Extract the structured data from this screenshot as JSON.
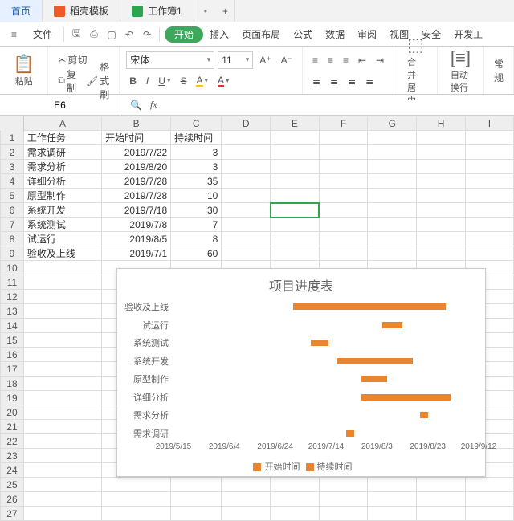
{
  "tabs": [
    {
      "label": "首页",
      "active": true,
      "icon": ""
    },
    {
      "label": "稻壳模板",
      "active": false,
      "icon": "red"
    },
    {
      "label": "工作簿1",
      "active": false,
      "icon": "green"
    }
  ],
  "menu": {
    "file": "文件",
    "items": [
      "开始",
      "插入",
      "页面布局",
      "公式",
      "数据",
      "审阅",
      "视图",
      "安全",
      "开发工"
    ],
    "activeIndex": 0
  },
  "ribbon": {
    "paste": "粘贴",
    "cut": "剪切",
    "copy": "复制",
    "format_painter": "格式刷",
    "font": "宋体",
    "size": "11",
    "bold": "B",
    "italic": "I",
    "underline": "U",
    "strike": "S",
    "fill": "A",
    "textcolor": "A",
    "merge": "合并居中",
    "wrap": "自动换行",
    "general": "常规"
  },
  "namebox": "E6",
  "fx_label": "fx",
  "columns": [
    "A",
    "B",
    "C",
    "D",
    "E",
    "F",
    "G",
    "H",
    "I"
  ],
  "rows_count": 27,
  "headers": {
    "task": "工作任务",
    "start": "开始时间",
    "dur": "持续时间"
  },
  "data": [
    {
      "task": "需求调研",
      "start": "2019/7/22",
      "dur": 3
    },
    {
      "task": "需求分析",
      "start": "2019/8/20",
      "dur": 3
    },
    {
      "task": "详细分析",
      "start": "2019/7/28",
      "dur": 35
    },
    {
      "task": "原型制作",
      "start": "2019/7/28",
      "dur": 10
    },
    {
      "task": "系统开发",
      "start": "2019/7/18",
      "dur": 30
    },
    {
      "task": "系统测试",
      "start": "2019/7/8",
      "dur": 7
    },
    {
      "task": "试运行",
      "start": "2019/8/5",
      "dur": 8
    },
    {
      "task": "验收及上线",
      "start": "2019/7/1",
      "dur": 60
    }
  ],
  "chart_data": {
    "type": "bar",
    "title": "项目进度表",
    "orientation": "horizontal",
    "x_axis_type": "date",
    "x_ticks": [
      "2019/5/15",
      "2019/6/4",
      "2019/6/24",
      "2019/7/14",
      "2019/8/3",
      "2019/8/23",
      "2019/9/12"
    ],
    "x_range": [
      "2019/5/15",
      "2019/9/12"
    ],
    "categories": [
      "验收及上线",
      "试运行",
      "系统测试",
      "系统开发",
      "原型制作",
      "详细分析",
      "需求分析",
      "需求调研"
    ],
    "series": [
      {
        "name": "开始时间",
        "role": "offset",
        "values": [
          "2019/7/1",
          "2019/8/5",
          "2019/7/8",
          "2019/7/18",
          "2019/7/28",
          "2019/7/28",
          "2019/8/20",
          "2019/7/22"
        ]
      },
      {
        "name": "持续时间",
        "role": "length_days",
        "color": "#e8852e",
        "values": [
          60,
          8,
          7,
          30,
          10,
          35,
          3,
          3
        ]
      }
    ],
    "legend": [
      "开始时间",
      "持续时间"
    ]
  }
}
